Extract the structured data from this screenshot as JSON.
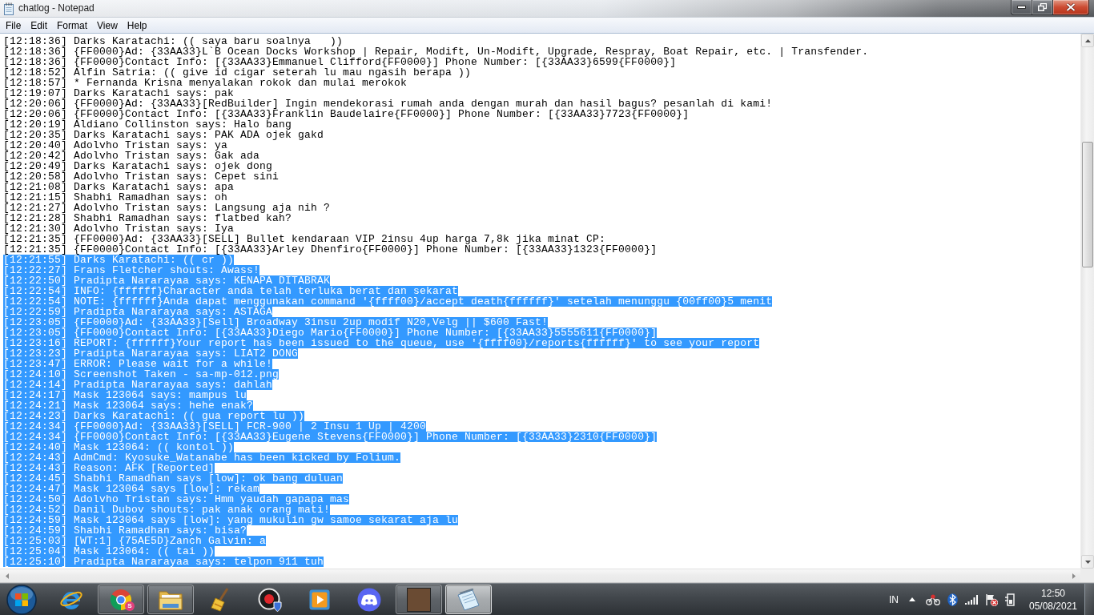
{
  "window": {
    "title": "chatlog - Notepad"
  },
  "menu": [
    "File",
    "Edit",
    "Format",
    "View",
    "Help"
  ],
  "editor": {
    "lines": [
      {
        "text": "[12:18:36] Darks Karatachi: (( saya baru soalnya   ))",
        "selected": false
      },
      {
        "text": "[12:18:36] {FF0000}Ad: {33AA33}L`B Ocean Docks Workshop | Repair, Modift, Un-Modift, Upgrade, Respray, Boat Repair, etc. | Transfender.",
        "selected": false
      },
      {
        "text": "[12:18:36] {FF0000}Contact Info: [{33AA33}Emmanuel Clifford{FF0000}] Phone Number: [{33AA33}6599{FF0000}]",
        "selected": false
      },
      {
        "text": "[12:18:52] Alfin Satria: (( give id cigar seterah lu mau ngasih berapa ))",
        "selected": false
      },
      {
        "text": "[12:18:57] * Fernanda Krisna menyalakan rokok dan mulai merokok",
        "selected": false
      },
      {
        "text": "[12:19:07] Darks Karatachi says: pak",
        "selected": false
      },
      {
        "text": "[12:20:06] {FF0000}Ad: {33AA33}[RedBuilder] Ingin mendekorasi rumah anda dengan murah dan hasil bagus? pesanlah di kami!",
        "selected": false
      },
      {
        "text": "[12:20:06] {FF0000}Contact Info: [{33AA33}Franklin Baudelaire{FF0000}] Phone Number: [{33AA33}7723{FF0000}]",
        "selected": false
      },
      {
        "text": "[12:20:19] Aldiano Collinston says: Halo bang",
        "selected": false
      },
      {
        "text": "[12:20:35] Darks Karatachi says: PAK ADA ojek gakd",
        "selected": false
      },
      {
        "text": "[12:20:40] Adolvho Tristan says: ya",
        "selected": false
      },
      {
        "text": "[12:20:42] Adolvho Tristan says: Gak ada",
        "selected": false
      },
      {
        "text": "[12:20:49] Darks Karatachi says: ojek dong",
        "selected": false
      },
      {
        "text": "[12:20:58] Adolvho Tristan says: Cepet sini",
        "selected": false
      },
      {
        "text": "[12:21:08] Darks Karatachi says: apa",
        "selected": false
      },
      {
        "text": "[12:21:15] Shabhi Ramadhan says: oh",
        "selected": false
      },
      {
        "text": "[12:21:27] Adolvho Tristan says: Langsung aja nih ?",
        "selected": false
      },
      {
        "text": "[12:21:28] Shabhi Ramadhan says: flatbed kah?",
        "selected": false
      },
      {
        "text": "[12:21:30] Adolvho Tristan says: Iya",
        "selected": false
      },
      {
        "text": "[12:21:35] {FF0000}Ad: {33AA33}[SELL] Bullet kendaraan VIP 2insu 4up harga 7,8k jika minat CP:",
        "selected": false
      },
      {
        "text": "[12:21:35] {FF0000}Contact Info: [{33AA33}Arley Dhenfiro{FF0000}] Phone Number: [{33AA33}1323{FF0000}]",
        "selected": false
      },
      {
        "text": "[12:21:55] Darks Karatachi: (( cr ))",
        "selected": true
      },
      {
        "text": "[12:22:27] Frans Fletcher shouts: Awass!",
        "selected": true
      },
      {
        "text": "[12:22:50] Pradipta Nararayaa says: KENAPA DITABRAK",
        "selected": true
      },
      {
        "text": "[12:22:54] INFO: {ffffff}Character anda telah terluka berat dan sekarat",
        "selected": true
      },
      {
        "text": "[12:22:54] NOTE: {ffffff}Anda dapat menggunakan command '{ffff00}/accept death{ffffff}' setelah menunggu {00ff00}5 menit",
        "selected": true
      },
      {
        "text": "[12:22:59] Pradipta Nararayaa says: ASTAGA",
        "selected": true
      },
      {
        "text": "[12:23:05] {FF0000}Ad: {33AA33}[Sell] Broadway 3insu 2up modif N20,Velg || $600 Fast!",
        "selected": true
      },
      {
        "text": "[12:23:05] {FF0000}Contact Info: [{33AA33}Diego Mario{FF0000}] Phone Number: [{33AA33}5555611{FF0000}]",
        "selected": true
      },
      {
        "text": "[12:23:16] REPORT: {ffffff}Your report has been issued to the queue, use '{ffff00}/reports{ffffff}' to see your report",
        "selected": true
      },
      {
        "text": "[12:23:23] Pradipta Nararayaa says: LIAT2 DONG",
        "selected": true
      },
      {
        "text": "[12:23:47] ERROR: Please wait for a while!",
        "selected": true
      },
      {
        "text": "[12:24:10] Screenshot Taken - sa-mp-012.png",
        "selected": true
      },
      {
        "text": "[12:24:14] Pradipta Nararayaa says: dahlah",
        "selected": true
      },
      {
        "text": "[12:24:17] Mask 123064 says: mampus lu",
        "selected": true
      },
      {
        "text": "[12:24:21] Mask 123064 says: hehe enak?",
        "selected": true
      },
      {
        "text": "[12:24:23] Darks Karatachi: (( gua report lu ))",
        "selected": true
      },
      {
        "text": "[12:24:34] {FF0000}Ad: {33AA33}[SELL] FCR-900 | 2 Insu 1 Up | 4200",
        "selected": true
      },
      {
        "text": "[12:24:34] {FF0000}Contact Info: [{33AA33}Eugene Stevens{FF0000}] Phone Number: [{33AA33}2310{FF0000}]",
        "selected": true
      },
      {
        "text": "[12:24:40] Mask 123064: (( kontol ))",
        "selected": true
      },
      {
        "text": "[12:24:43] AdmCmd: Kyosuke_Watanabe has been kicked by Folium.",
        "selected": true
      },
      {
        "text": "[12:24:43] Reason: AFK [Reported]",
        "selected": true
      },
      {
        "text": "[12:24:45] Shabhi Ramadhan says [low]: ok bang duluan",
        "selected": true
      },
      {
        "text": "[12:24:47] Mask 123064 says [low]: rekam",
        "selected": true
      },
      {
        "text": "[12:24:50] Adolvho Tristan says: Hmm yaudah gapapa mas",
        "selected": true
      },
      {
        "text": "[12:24:52] Danil Dubov shouts: pak anak orang mati!",
        "selected": true
      },
      {
        "text": "[12:24:59] Mask 123064 says [low]: yang mukulin gw samoe sekarat aja lu",
        "selected": true
      },
      {
        "text": "[12:24:59] Shabhi Ramadhan says: bisa?",
        "selected": true
      },
      {
        "text": "[12:25:03] [WT:1] {75AE5D}Zanch Galvin: a",
        "selected": true
      },
      {
        "text": "[12:25:04] Mask 123064: (( tai ))",
        "selected": true
      },
      {
        "text": "[12:25:10] Pradipta Nararayaa says: telpon 911 tuh",
        "selected": true
      }
    ]
  },
  "taskbar": {
    "apps": [
      {
        "running": false,
        "selected": false
      },
      {
        "running": true,
        "selected": false,
        "badge": "S"
      },
      {
        "running": true,
        "selected": false
      },
      {
        "running": false,
        "selected": false
      },
      {
        "running": false,
        "selected": false
      },
      {
        "running": false,
        "selected": false
      },
      {
        "running": false,
        "selected": false
      },
      {
        "running": true,
        "selected": false
      },
      {
        "running": true,
        "selected": true
      }
    ],
    "language": "IN",
    "time": "12:50",
    "date": "05/08/2021"
  }
}
